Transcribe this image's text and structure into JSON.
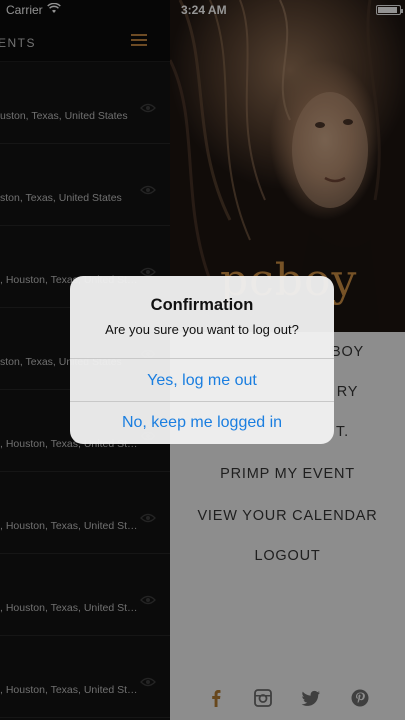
{
  "status_bar": {
    "carrier": "Carrier",
    "time": "3:24 AM"
  },
  "events_panel": {
    "title": "ENTS",
    "rows": [
      {
        "location": "uston, Texas, United States"
      },
      {
        "location": "ston, Texas, United States"
      },
      {
        "location": ", Houston, Texas, United States"
      },
      {
        "location": "ston, Texas, United States"
      },
      {
        "location": ", Houston, Texas, United States"
      },
      {
        "location": ", Houston, Texas, United States"
      },
      {
        "location": ", Houston, Texas, United States"
      },
      {
        "location": ", Houston, Texas, United States"
      }
    ]
  },
  "hero": {
    "brand": "pcboy"
  },
  "side_menu": {
    "items": [
      {
        "label": "BOY"
      },
      {
        "label": "RY"
      },
      {
        "label": "T."
      },
      {
        "label": "PRIMP MY EVENT"
      },
      {
        "label": "VIEW YOUR CALENDAR"
      },
      {
        "label": "LOGOUT"
      }
    ],
    "social": [
      "facebook-icon",
      "instagram-icon",
      "twitter-icon",
      "pinterest-icon"
    ]
  },
  "alert": {
    "title": "Confirmation",
    "message": "Are you sure you want to log out?",
    "confirm_label": "Yes, log me out",
    "cancel_label": "No, keep me logged in"
  },
  "colors": {
    "accent": "#b07a3b",
    "alert_button": "#1a7ee0",
    "menu_bg": "#e4e4e4"
  }
}
